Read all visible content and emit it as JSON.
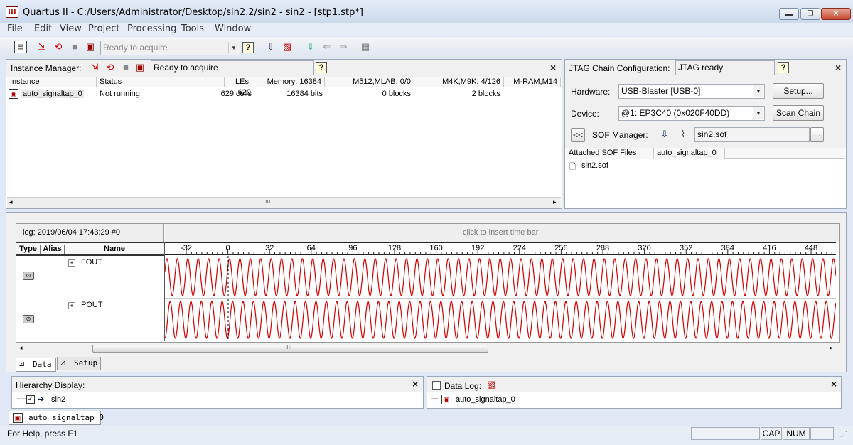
{
  "window": {
    "title": "Quartus II - C:/Users/Administrator/Desktop/sin2.2/sin2 - sin2 - [stp1.stp*]",
    "app_icon": "Quartus-logo-icon",
    "controls": [
      "minimize-icon",
      "maximize-icon",
      "close-icon"
    ]
  },
  "menu": [
    "File",
    "Edit",
    "View",
    "Project",
    "Processing",
    "Tools",
    "Window"
  ],
  "toolbar": {
    "status_combo": "Ready to acquire",
    "icons": [
      "setup-icon",
      "autorun-icon",
      "run-icon",
      "stop-icon",
      "read-data-icon",
      "help-icon",
      "program-icon",
      "sof-icon",
      "download-icon",
      "back-icon",
      "forward-icon",
      "grid-icon"
    ]
  },
  "instance_manager": {
    "label": "Instance Manager:",
    "status": "Ready to acquire",
    "columns": [
      "Instance",
      "Status",
      "LEs: 629",
      "Memory: 16384",
      "M512,MLAB: 0/0",
      "M4K,M9K: 4/126",
      "M-RAM,M14"
    ],
    "rows": [
      {
        "instance": "auto_signaltap_0",
        "status": "Not running",
        "les": "629 cells",
        "memory": "16384 bits",
        "m512": "0 blocks",
        "m4k": "2 blocks",
        "mram": ""
      }
    ]
  },
  "jtag": {
    "label": "JTAG Chain Configuration:",
    "status": "JTAG ready",
    "hardware_label": "Hardware:",
    "hardware_value": "USB-Blaster [USB-0]",
    "setup_button": "Setup...",
    "device_label": "Device:",
    "device_value": "@1: EP3C40 (0x020F40DD)",
    "scan_button": "Scan Chain",
    "collapse_button": "<<",
    "sof_label": "SOF Manager:",
    "sof_file": "sin2.sof",
    "browse_button": "...",
    "attached_columns": [
      "Attached SOF Files",
      "auto_signaltap_0"
    ],
    "attached_files": [
      "sin2.sof"
    ]
  },
  "waveform": {
    "log_label": "log: 2019/06/04 17:43:29  #0",
    "insert_hint": "click to insert time bar",
    "columns": [
      "Type",
      "Alias",
      "Name"
    ],
    "ticks": [
      "-32",
      "0",
      "32",
      "64",
      "96",
      "128",
      "160",
      "192",
      "224",
      "256",
      "288",
      "320",
      "352",
      "384",
      "416",
      "448"
    ],
    "signals": [
      {
        "name": "FOUT",
        "expand": "+",
        "type_icon": "signal-type-icon",
        "phase": 0.05
      },
      {
        "name": "POUT",
        "expand": "+",
        "type_icon": "signal-type-icon",
        "phase": 0.75
      }
    ],
    "wave_color": "#d40000"
  },
  "bottom_tabs": [
    "Data",
    "Setup"
  ],
  "hierarchy": {
    "label": "Hierarchy Display:",
    "items": [
      {
        "name": "sin2",
        "checked": true
      }
    ]
  },
  "data_log": {
    "label": "Data Log:",
    "items": [
      "auto_signaltap_0"
    ]
  },
  "instance_tab": "auto_signaltap_0",
  "status_bar": {
    "help": "For Help, press F1",
    "cap": "CAP",
    "num": "NUM"
  }
}
